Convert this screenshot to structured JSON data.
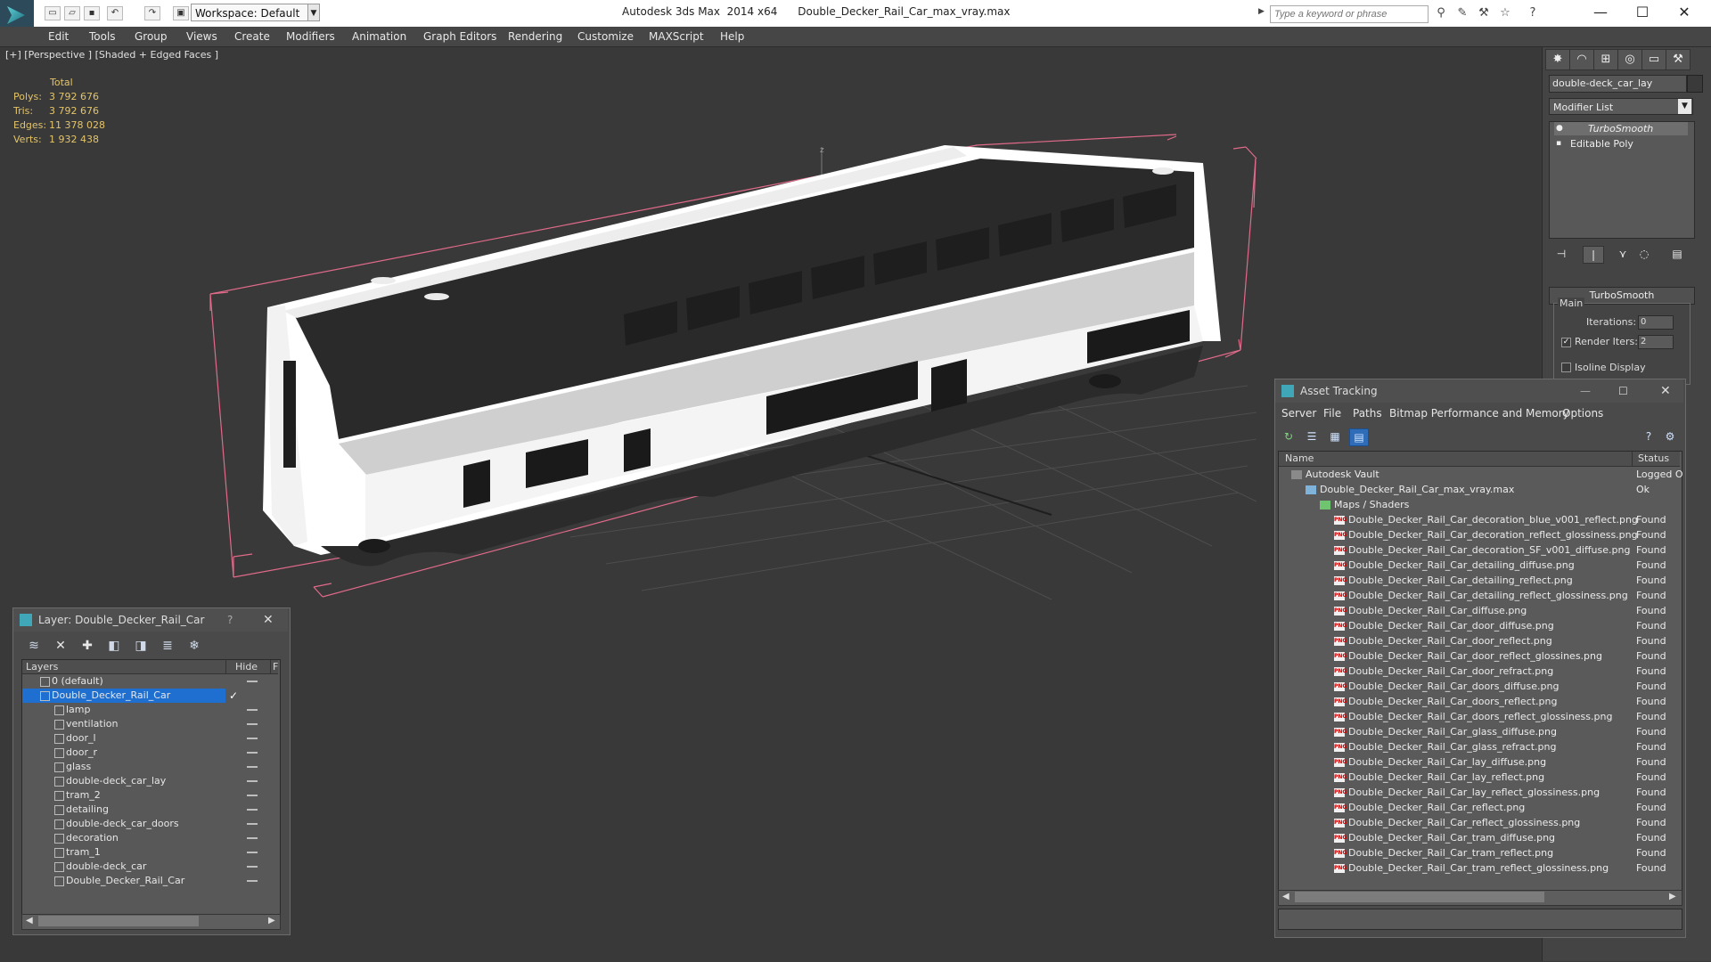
{
  "title_bar": {
    "workspace": "Workspace: Default",
    "app_title": "Autodesk 3ds Max  2014 x64      Double_Decker_Rail_Car_max_vray.max",
    "search_placeholder": "Type a keyword or phrase"
  },
  "menu": [
    "Edit",
    "Tools",
    "Group",
    "Views",
    "Create",
    "Modifiers",
    "Animation",
    "Graph Editors",
    "Rendering",
    "Customize",
    "MAXScript",
    "Help"
  ],
  "viewport": {
    "label": "[+] [Perspective ] [Shaded + Edged Faces ]",
    "stats_header": "Total",
    "stats": [
      {
        "label": "Polys:",
        "value": "3 792 676"
      },
      {
        "label": "Tris:",
        "value": "3 792 676"
      },
      {
        "label": "Edges:",
        "value": "11 378 028"
      },
      {
        "label": "Verts:",
        "value": "1 932 438"
      }
    ],
    "axis_label": "z"
  },
  "command_panel": {
    "object_name": "double-deck_car_lay",
    "modifier_list": "Modifier List",
    "stack": [
      "TurboSmooth",
      "Editable Poly"
    ],
    "rollout_title": "TurboSmooth",
    "group_main": "Main",
    "iterations_label": "Iterations:",
    "iterations_value": "0",
    "render_iters_label": "Render Iters:",
    "render_iters_value": "2",
    "isoline_label": "Isoline Display"
  },
  "layer_panel": {
    "title": "Layer: Double_Decker_Rail_Car",
    "help": "?",
    "col_layers": "Layers",
    "col_hide": "Hide",
    "col_f": "F",
    "rows": [
      {
        "name": "0 (default)",
        "level": 0
      },
      {
        "name": "Double_Decker_Rail_Car",
        "level": 0,
        "selected": true
      },
      {
        "name": "lamp",
        "level": 1
      },
      {
        "name": "ventilation",
        "level": 1
      },
      {
        "name": "door_l",
        "level": 1
      },
      {
        "name": "door_r",
        "level": 1
      },
      {
        "name": "glass",
        "level": 1
      },
      {
        "name": "double-deck_car_lay",
        "level": 1
      },
      {
        "name": "tram_2",
        "level": 1
      },
      {
        "name": "detailing",
        "level": 1
      },
      {
        "name": "double-deck_car_doors",
        "level": 1
      },
      {
        "name": "decoration",
        "level": 1
      },
      {
        "name": "tram_1",
        "level": 1
      },
      {
        "name": "double-deck_car",
        "level": 1
      },
      {
        "name": "Double_Decker_Rail_Car",
        "level": 1
      }
    ]
  },
  "asset_tracking": {
    "title": "Asset Tracking",
    "menu": [
      "Server",
      "File",
      "Paths",
      "Bitmap Performance and Memory",
      "Options"
    ],
    "col_name": "Name",
    "col_status": "Status",
    "rows": [
      {
        "name": "Autodesk Vault",
        "status": "Logged O",
        "level": 0,
        "type": "vault"
      },
      {
        "name": "Double_Decker_Rail_Car_max_vray.max",
        "status": "Ok",
        "level": 1,
        "type": "max"
      },
      {
        "name": "Maps / Shaders",
        "status": "",
        "level": 2,
        "type": "maps"
      },
      {
        "name": "Double_Decker_Rail_Car_decoration_blue_v001_reflect.png",
        "status": "Found",
        "level": 3,
        "type": "png"
      },
      {
        "name": "Double_Decker_Rail_Car_decoration_reflect_glossiness.png",
        "status": "Found",
        "level": 3,
        "type": "png"
      },
      {
        "name": "Double_Decker_Rail_Car_decoration_SF_v001_diffuse.png",
        "status": "Found",
        "level": 3,
        "type": "png"
      },
      {
        "name": "Double_Decker_Rail_Car_detailing_diffuse.png",
        "status": "Found",
        "level": 3,
        "type": "png"
      },
      {
        "name": "Double_Decker_Rail_Car_detailing_reflect.png",
        "status": "Found",
        "level": 3,
        "type": "png"
      },
      {
        "name": "Double_Decker_Rail_Car_detailing_reflect_glossiness.png",
        "status": "Found",
        "level": 3,
        "type": "png"
      },
      {
        "name": "Double_Decker_Rail_Car_diffuse.png",
        "status": "Found",
        "level": 3,
        "type": "png"
      },
      {
        "name": "Double_Decker_Rail_Car_door_diffuse.png",
        "status": "Found",
        "level": 3,
        "type": "png"
      },
      {
        "name": "Double_Decker_Rail_Car_door_reflect.png",
        "status": "Found",
        "level": 3,
        "type": "png"
      },
      {
        "name": "Double_Decker_Rail_Car_door_reflect_glossines.png",
        "status": "Found",
        "level": 3,
        "type": "png"
      },
      {
        "name": "Double_Decker_Rail_Car_door_refract.png",
        "status": "Found",
        "level": 3,
        "type": "png"
      },
      {
        "name": "Double_Decker_Rail_Car_doors_diffuse.png",
        "status": "Found",
        "level": 3,
        "type": "png"
      },
      {
        "name": "Double_Decker_Rail_Car_doors_reflect.png",
        "status": "Found",
        "level": 3,
        "type": "png"
      },
      {
        "name": "Double_Decker_Rail_Car_doors_reflect_glossiness.png",
        "status": "Found",
        "level": 3,
        "type": "png"
      },
      {
        "name": "Double_Decker_Rail_Car_glass_diffuse.png",
        "status": "Found",
        "level": 3,
        "type": "png"
      },
      {
        "name": "Double_Decker_Rail_Car_glass_refract.png",
        "status": "Found",
        "level": 3,
        "type": "png"
      },
      {
        "name": "Double_Decker_Rail_Car_lay_diffuse.png",
        "status": "Found",
        "level": 3,
        "type": "png"
      },
      {
        "name": "Double_Decker_Rail_Car_lay_reflect.png",
        "status": "Found",
        "level": 3,
        "type": "png"
      },
      {
        "name": "Double_Decker_Rail_Car_lay_reflect_glossiness.png",
        "status": "Found",
        "level": 3,
        "type": "png"
      },
      {
        "name": "Double_Decker_Rail_Car_reflect.png",
        "status": "Found",
        "level": 3,
        "type": "png"
      },
      {
        "name": "Double_Decker_Rail_Car_reflect_glossiness.png",
        "status": "Found",
        "level": 3,
        "type": "png"
      },
      {
        "name": "Double_Decker_Rail_Car_tram_diffuse.png",
        "status": "Found",
        "level": 3,
        "type": "png"
      },
      {
        "name": "Double_Decker_Rail_Car_tram_reflect.png",
        "status": "Found",
        "level": 3,
        "type": "png"
      },
      {
        "name": "Double_Decker_Rail_Car_tram_reflect_glossiness.png",
        "status": "Found",
        "level": 3,
        "type": "png"
      }
    ]
  },
  "colors": {
    "viewport_bg": "#393939",
    "stats_text": "#e3c46a",
    "selection": "#1f6fd0",
    "bbox": "#e06a8a",
    "model": "#ffffff"
  }
}
